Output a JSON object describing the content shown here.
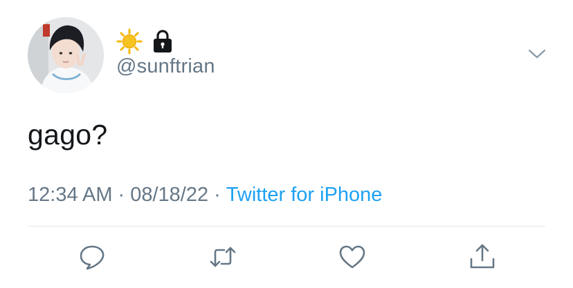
{
  "tweet": {
    "handle": "@sunftrian",
    "name_emoji_icon": "sun-icon",
    "protected_icon": "lock-icon",
    "text": "gago?",
    "time": "12:34 AM",
    "separator": "·",
    "date": "08/18/22",
    "source": "Twitter for iPhone"
  },
  "actions": {
    "icons": [
      "reply-icon",
      "retweet-icon",
      "like-icon",
      "share-icon"
    ]
  },
  "colors": {
    "text": "#14171a",
    "secondary": "#657786",
    "link": "#1da1f2",
    "divider": "#e1e8ed",
    "sun": "#f5b70a"
  }
}
